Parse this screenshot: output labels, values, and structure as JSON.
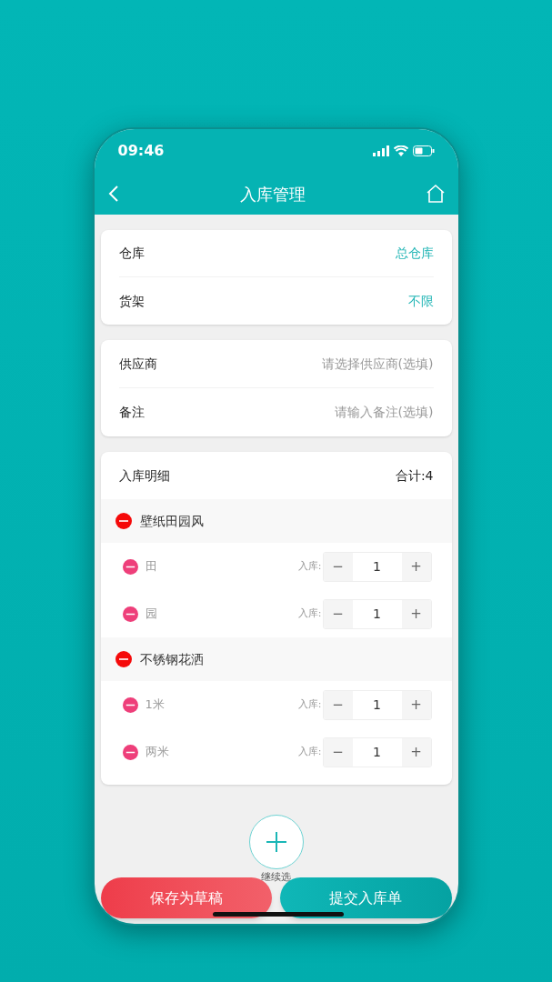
{
  "status_bar": {
    "time": "09:46"
  },
  "header": {
    "title": "入库管理"
  },
  "location_card": [
    {
      "label": "仓库",
      "value": "总仓库"
    },
    {
      "label": "货架",
      "value": "不限"
    }
  ],
  "info_card": [
    {
      "label": "供应商",
      "placeholder": "请选择供应商(选填)"
    },
    {
      "label": "备注",
      "placeholder": "请输入备注(选填)"
    }
  ],
  "details": {
    "title": "入库明细",
    "total": "合计:4",
    "groups": [
      {
        "name": "壁纸田园风",
        "children": [
          {
            "name": "田",
            "qty_label": "入库:",
            "minus": "−",
            "quantity": "1",
            "plus": "+"
          },
          {
            "name": "园",
            "qty_label": "入库:",
            "minus": "−",
            "quantity": "1",
            "plus": "+"
          }
        ]
      },
      {
        "name": "不锈钢花洒",
        "children": [
          {
            "name": "1米",
            "qty_label": "入库:",
            "minus": "−",
            "quantity": "1",
            "plus": "+"
          },
          {
            "name": "两米",
            "qty_label": "入库:",
            "minus": "−",
            "quantity": "1",
            "plus": "+"
          }
        ]
      }
    ]
  },
  "add_more": {
    "label": "继续选"
  },
  "buttons": [
    {
      "label": "保存为草稿",
      "kind": "draft"
    },
    {
      "label": "提交入库单",
      "kind": "submit"
    }
  ]
}
